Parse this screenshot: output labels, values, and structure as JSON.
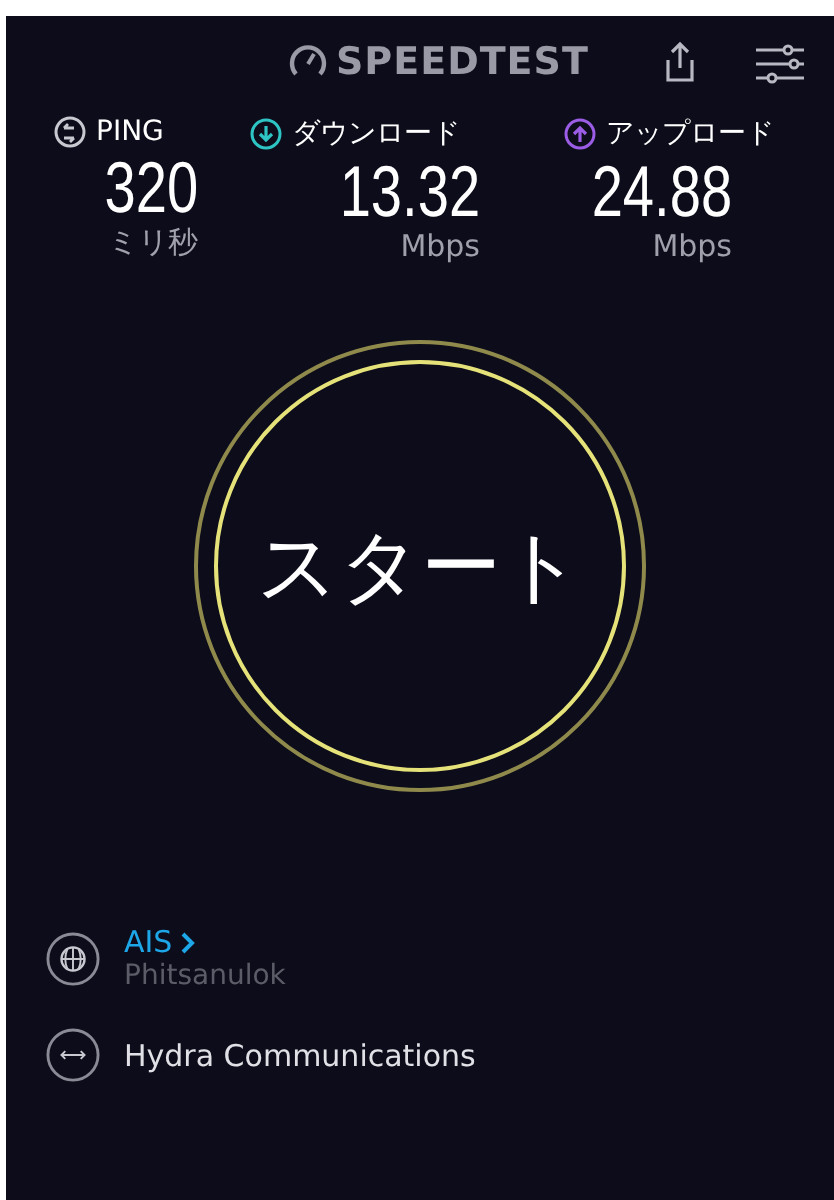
{
  "header": {
    "logo": "SPEEDTEST"
  },
  "metrics": [
    {
      "kind": "ping",
      "label": "PING",
      "value": "320",
      "unit": "ミリ秒",
      "color": "#c8c8d0"
    },
    {
      "kind": "download",
      "label": "ダウンロード",
      "value": "13.32",
      "unit": "Mbps",
      "color": "#2ec4c4"
    },
    {
      "kind": "upload",
      "label": "アップロード",
      "value": "24.88",
      "unit": "Mbps",
      "color": "#9b5de5"
    }
  ],
  "start_button": {
    "label": "スタート"
  },
  "server": {
    "provider": "AIS",
    "location": "Phitsanulok",
    "host": "Hydra Communications"
  }
}
